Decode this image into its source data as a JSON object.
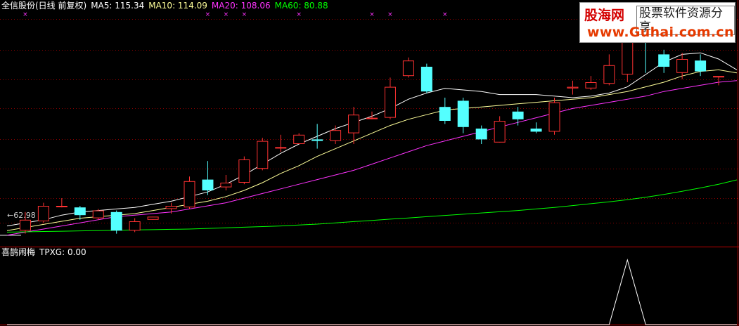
{
  "header": {
    "title": "全信股份(日线 前复权)",
    "ma5_label": "MA5: 115.34",
    "ma10_label": "MA10: 114.09",
    "ma20_label": "MA20: 108.06",
    "ma60_label": "MA60: 80.88"
  },
  "sub_header": {
    "indicator": "喜鹊闹梅",
    "value_label": "TPXG: 0.00"
  },
  "low_marker": "62.98",
  "watermark": {
    "line1": "股海网",
    "line2": "股票软件资源分享",
    "line3": "www.Guhai.com.cn"
  },
  "colors": {
    "background": "#000000",
    "up": "#ff3232",
    "down": "#54ffff",
    "ma5": "#ffffff",
    "ma10": "#ffff9a",
    "ma20": "#ff33ff",
    "ma60": "#00ff00",
    "grid": "#8b0000",
    "marker": "#ff33ff"
  },
  "chart_data": {
    "type": "candlestick",
    "series": [
      {
        "name": "MA5",
        "values": [
          66.0,
          67.0,
          68.0,
          69.5,
          70.5,
          71.0,
          71.5,
          72.0,
          73.0,
          74.0,
          75.5,
          77.0,
          79.5,
          82.5,
          86.0,
          89.5,
          92.5,
          95.0,
          97.5,
          99.5,
          101.5,
          104.0,
          107.0,
          109.0,
          110.5,
          110.0,
          109.5,
          108.5,
          108.5,
          108.5,
          108.0,
          107.5,
          108.0,
          109.0,
          111.0,
          115.0,
          119.0,
          121.5,
          122.0,
          120.0,
          116.5
        ]
      },
      {
        "name": "MA10",
        "values": [
          64.5,
          65.5,
          66.5,
          67.5,
          68.5,
          69.0,
          69.5,
          70.0,
          71.0,
          72.0,
          73.0,
          74.0,
          75.5,
          77.5,
          80.0,
          83.0,
          85.5,
          88.5,
          91.0,
          93.5,
          96.0,
          98.5,
          100.5,
          102.0,
          103.5,
          104.0,
          104.5,
          105.0,
          105.5,
          106.0,
          106.5,
          107.0,
          107.5,
          108.5,
          109.5,
          111.0,
          112.5,
          114.5,
          116.0,
          116.5,
          115.5
        ]
      },
      {
        "name": "MA20",
        "values": [
          63.0,
          64.0,
          65.0,
          66.0,
          67.0,
          68.0,
          69.0,
          69.5,
          70.0,
          70.5,
          71.5,
          72.5,
          73.5,
          75.0,
          76.5,
          78.0,
          79.5,
          81.0,
          82.5,
          84.0,
          86.0,
          88.0,
          90.0,
          92.0,
          93.5,
          95.0,
          96.5,
          98.0,
          99.5,
          101.0,
          102.5,
          104.0,
          105.0,
          106.0,
          107.0,
          108.0,
          109.5,
          110.5,
          111.5,
          112.5,
          113.0
        ]
      },
      {
        "name": "MA60",
        "values": [
          64.0,
          64.1,
          64.2,
          64.3,
          64.4,
          64.5,
          64.6,
          64.7,
          64.8,
          64.9,
          65.0,
          65.2,
          65.4,
          65.6,
          65.8,
          66.0,
          66.3,
          66.6,
          67.0,
          67.4,
          67.8,
          68.2,
          68.6,
          69.0,
          69.4,
          69.8,
          70.2,
          70.6,
          71.0,
          71.5,
          72.0,
          72.6,
          73.2,
          73.8,
          74.5,
          75.3,
          76.2,
          77.2,
          78.3,
          79.5,
          80.9
        ]
      }
    ],
    "candles": [
      {
        "o": 64.5,
        "h": 70.5,
        "l": 63.5,
        "c": 68.0
      },
      {
        "o": 67.5,
        "h": 73.5,
        "l": 67.0,
        "c": 72.5
      },
      {
        "o": 72.5,
        "h": 75.0,
        "l": 72.0,
        "c": 72.5
      },
      {
        "o": 72.0,
        "h": 72.5,
        "l": 68.0,
        "c": 69.5
      },
      {
        "o": 68.5,
        "h": 71.5,
        "l": 68.0,
        "c": 71.0
      },
      {
        "o": 70.5,
        "h": 71.0,
        "l": 63.5,
        "c": 64.5
      },
      {
        "o": 64.5,
        "h": 68.5,
        "l": 64.0,
        "c": 67.5
      },
      {
        "o": 68.0,
        "h": 69.0,
        "l": 68.0,
        "c": 69.0
      },
      {
        "o": 71.5,
        "h": 73.5,
        "l": 70.0,
        "c": 72.5
      },
      {
        "o": 72.0,
        "h": 82.0,
        "l": 71.5,
        "c": 80.5
      },
      {
        "o": 81.0,
        "h": 87.0,
        "l": 76.0,
        "c": 77.5
      },
      {
        "o": 78.5,
        "h": 82.5,
        "l": 77.5,
        "c": 80.0
      },
      {
        "o": 80.0,
        "h": 88.5,
        "l": 79.5,
        "c": 87.5
      },
      {
        "o": 84.5,
        "h": 94.5,
        "l": 84.0,
        "c": 93.5
      },
      {
        "o": 91.5,
        "h": 95.5,
        "l": 90.0,
        "c": 91.5
      },
      {
        "o": 92.5,
        "h": 96.0,
        "l": 92.5,
        "c": 95.5
      },
      {
        "o": 94.0,
        "h": 99.0,
        "l": 91.0,
        "c": 93.5
      },
      {
        "o": 93.5,
        "h": 98.5,
        "l": 92.5,
        "c": 97.0
      },
      {
        "o": 96.0,
        "h": 104.5,
        "l": 92.5,
        "c": 102.0
      },
      {
        "o": 101.0,
        "h": 103.0,
        "l": 100.5,
        "c": 101.0
      },
      {
        "o": 101.0,
        "h": 114.0,
        "l": 100.5,
        "c": 111.0
      },
      {
        "o": 114.5,
        "h": 120.5,
        "l": 114.0,
        "c": 119.5
      },
      {
        "o": 117.5,
        "h": 118.5,
        "l": 109.0,
        "c": 109.5
      },
      {
        "o": 104.5,
        "h": 107.5,
        "l": 99.0,
        "c": 100.0
      },
      {
        "o": 106.5,
        "h": 107.5,
        "l": 96.0,
        "c": 98.0
      },
      {
        "o": 97.5,
        "h": 98.5,
        "l": 92.5,
        "c": 94.0
      },
      {
        "o": 93.0,
        "h": 101.5,
        "l": 93.0,
        "c": 100.0
      },
      {
        "o": 103.0,
        "h": 104.5,
        "l": 98.5,
        "c": 100.5
      },
      {
        "o": 97.5,
        "h": 99.5,
        "l": 96.0,
        "c": 96.5
      },
      {
        "o": 96.5,
        "h": 107.5,
        "l": 95.5,
        "c": 106.0
      },
      {
        "o": 110.5,
        "h": 113.0,
        "l": 108.5,
        "c": 111.0
      },
      {
        "o": 110.5,
        "h": 114.5,
        "l": 110.0,
        "c": 112.5
      },
      {
        "o": 112.0,
        "h": 121.5,
        "l": 111.5,
        "c": 118.0
      },
      {
        "o": 115.0,
        "h": 130.0,
        "l": 112.5,
        "c": 129.0
      },
      {
        "o": 131.0,
        "h": 131.5,
        "l": 115.5,
        "c": 126.5
      },
      {
        "o": 121.5,
        "h": 123.0,
        "l": 115.5,
        "c": 117.5
      },
      {
        "o": 115.5,
        "h": 122.0,
        "l": 113.5,
        "c": 120.0
      },
      {
        "o": 119.5,
        "h": 121.5,
        "l": 114.5,
        "c": 116.0
      },
      {
        "o": 114.5,
        "h": 114.5,
        "l": 111.5,
        "c": 114.5
      }
    ],
    "candle_index_offset": 1,
    "low": 62.98,
    "price_range": [
      60.0,
      135.0
    ],
    "grid_prices": [
      67.0,
      75.0,
      84.5,
      94.0,
      104.0,
      113.5,
      123.0,
      133.0
    ],
    "marker_indices": [
      1,
      11,
      12,
      13,
      16,
      20,
      21,
      24
    ],
    "indicator": {
      "name": "TPXG",
      "values": [
        0,
        0,
        0,
        0,
        0,
        0,
        0,
        0,
        0,
        0,
        0,
        0,
        0,
        0,
        0,
        0,
        0,
        0,
        0,
        0,
        0,
        0,
        0,
        0,
        0,
        0,
        0,
        0,
        0,
        0,
        0,
        0,
        0,
        0,
        1,
        0,
        0,
        0,
        0,
        0,
        0
      ],
      "range": [
        0,
        1
      ]
    }
  }
}
